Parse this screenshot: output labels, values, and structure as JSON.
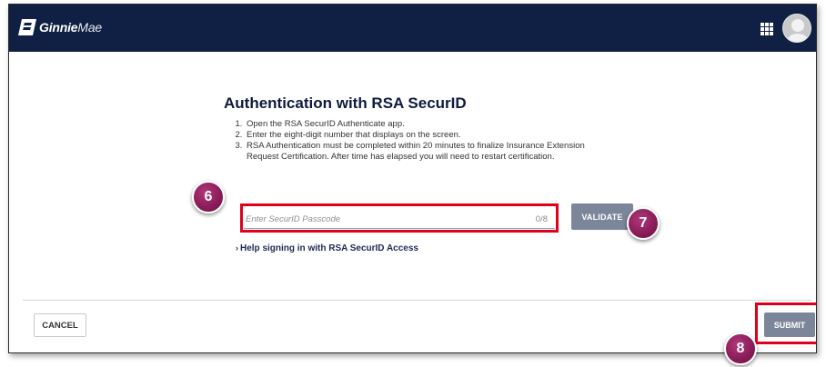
{
  "header": {
    "brand_bold": "Ginnie",
    "brand_light": "Mae",
    "logo_icon": "ginnie-mae-logo-icon",
    "apps_icon": "grid-apps-icon",
    "avatar_icon": "user-avatar"
  },
  "main": {
    "title": "Authentication with RSA SecurID",
    "steps": [
      "Open the RSA SecurID Authenticate app.",
      "Enter the eight-digit number that displays on the screen.",
      "RSA Authentication must be completed within 20 minutes to finalize Insurance Extension Request Certification. After time has elapsed you will need to restart certification."
    ],
    "passcode": {
      "placeholder": "Enter SecurID Passcode",
      "value": "",
      "counter": "0/8"
    },
    "validate_label": "VALIDATE",
    "help_chevron": "›",
    "help_label": "Help signing in with RSA SecurID Access"
  },
  "footer": {
    "cancel_label": "CANCEL",
    "submit_label": "SUBMIT"
  },
  "annotations": [
    {
      "number": "6"
    },
    {
      "number": "7"
    },
    {
      "number": "8"
    }
  ],
  "colors": {
    "header_bg": "#0f2044",
    "highlight": "#e0001b",
    "button_bg": "#7c869a",
    "marker": "#8c1d5a"
  }
}
